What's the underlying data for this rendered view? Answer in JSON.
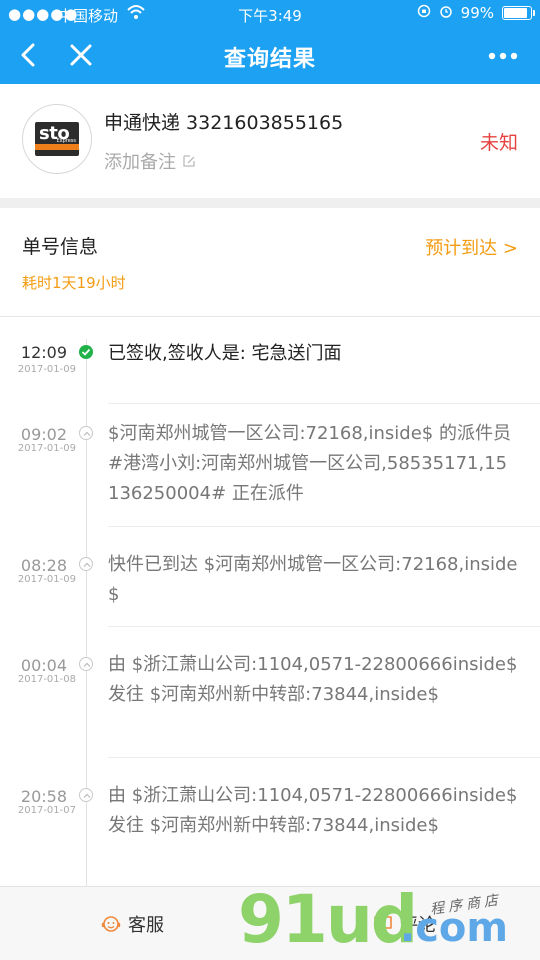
{
  "status_bar": {
    "signal": "●●●●●",
    "carrier": "中国移动",
    "time": "下午3:49",
    "battery": "99%"
  },
  "nav": {
    "title": "查询结果"
  },
  "courier": {
    "logo_text": "sto",
    "logo_tag": "Express",
    "name": "申通快递 3321603855165",
    "note_label": "添加备注",
    "state": "未知"
  },
  "info": {
    "heading": "单号信息",
    "eta_label": "预计到达 >",
    "elapsed": "耗时1天19小时"
  },
  "timeline": [
    {
      "time": "12:09",
      "date": "2017-01-09",
      "status": "done",
      "text": "已签收,签收人是: 宅急送门面"
    },
    {
      "time": "09:02",
      "date": "2017-01-09",
      "status": "pending",
      "text": "$河南郑州城管一区公司:72168,inside$ 的派件员 #港湾小刘:河南郑州城管一区公司,58535171,15136250004# 正在派件"
    },
    {
      "time": "08:28",
      "date": "2017-01-09",
      "status": "pending",
      "text": "快件已到达 $河南郑州城管一区公司:72168,inside$"
    },
    {
      "time": "00:04",
      "date": "2017-01-08",
      "status": "pending",
      "text": "由 $浙江萧山公司:1104,0571-22800666inside$ 发往 $河南郑州新中转部:73844,inside$"
    },
    {
      "time": "20:58",
      "date": "2017-01-07",
      "status": "pending",
      "text": "由 $浙江萧山公司:1104,0571-22800666inside$ 发往 $河南郑州新中转部:73844,inside$"
    }
  ],
  "bottom": {
    "service_label": "客服",
    "comment_label": "评论"
  },
  "watermark": {
    "main": "91ud",
    "suffix": ".com",
    "sub": "程序商店"
  },
  "colors": {
    "header": "#1da1f2",
    "unknown_state": "#e64340",
    "accent_orange": "#f39c12",
    "done_green": "#21b24a"
  },
  "icons": {
    "back": "chevron-left-icon",
    "close": "close-icon",
    "more": "more-dots-icon",
    "edit": "edit-icon",
    "service": "service-icon",
    "comment": "comment-icon"
  }
}
